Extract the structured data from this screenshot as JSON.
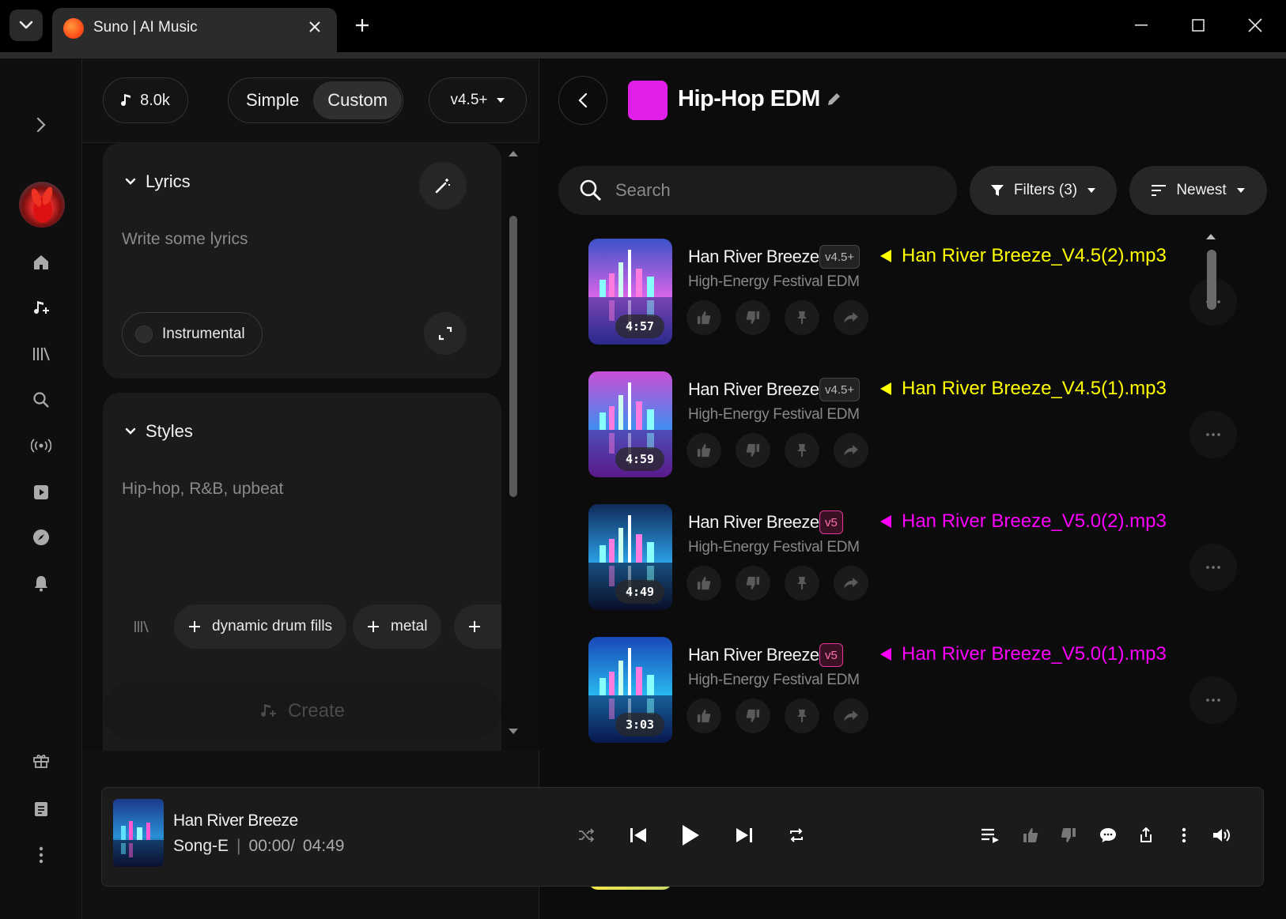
{
  "window": {
    "tab_title": "Suno | AI Music"
  },
  "rail": {
    "items": [
      "expand-icon",
      "avatar",
      "home-icon",
      "create-icon",
      "library-icon",
      "search-icon",
      "radio-icon",
      "video-icon",
      "explore-icon",
      "notifications-icon",
      "gift-icon",
      "document-icon",
      "more-icon"
    ]
  },
  "composer": {
    "credits": "8.0k",
    "modes": [
      "Simple",
      "Custom"
    ],
    "active_mode": "Custom",
    "model_version": "v4.5+",
    "lyrics": {
      "label": "Lyrics",
      "placeholder": "Write some lyrics",
      "instrumental_label": "Instrumental"
    },
    "styles": {
      "label": "Styles",
      "value": "Hip-hop, R&B, upbeat",
      "suggestions": [
        "dynamic drum fills",
        "metal"
      ]
    },
    "create_label": "Create"
  },
  "library": {
    "playlist_title": "Hip-Hop EDM",
    "playlist_color": "#e020e8",
    "search_placeholder": "Search",
    "filters_label": "Filters (3)",
    "sort_label": "Newest",
    "songs": [
      {
        "title": "Han River Breeze",
        "version": "v4.5+",
        "subtitle": "High-Energy Festival EDM",
        "duration": "4:57",
        "annotation": "Han River Breeze_V4.5(2).mp3",
        "annotation_color": "#ffff00"
      },
      {
        "title": "Han River Breeze",
        "version": "v4.5+",
        "subtitle": "High-Energy Festival EDM",
        "duration": "4:59",
        "annotation": "Han River Breeze_V4.5(1).mp3",
        "annotation_color": "#ffff00"
      },
      {
        "title": "Han River Breeze",
        "version": "v5",
        "subtitle": "High-Energy Festival EDM",
        "duration": "4:49",
        "annotation": "Han River Breeze_V5.0(2).mp3",
        "annotation_color": "#ff00ff"
      },
      {
        "title": "Han River Breeze",
        "version": "v5",
        "subtitle": "High-Energy Festival EDM",
        "duration": "3:03",
        "annotation": "Han River Breeze_V5.0(1).mp3",
        "annotation_color": "#ff00ff"
      }
    ]
  },
  "player": {
    "title": "Han River Breeze",
    "artist": "Song-E",
    "separator": "|",
    "elapsed": "00:00/",
    "total": "04:49"
  }
}
